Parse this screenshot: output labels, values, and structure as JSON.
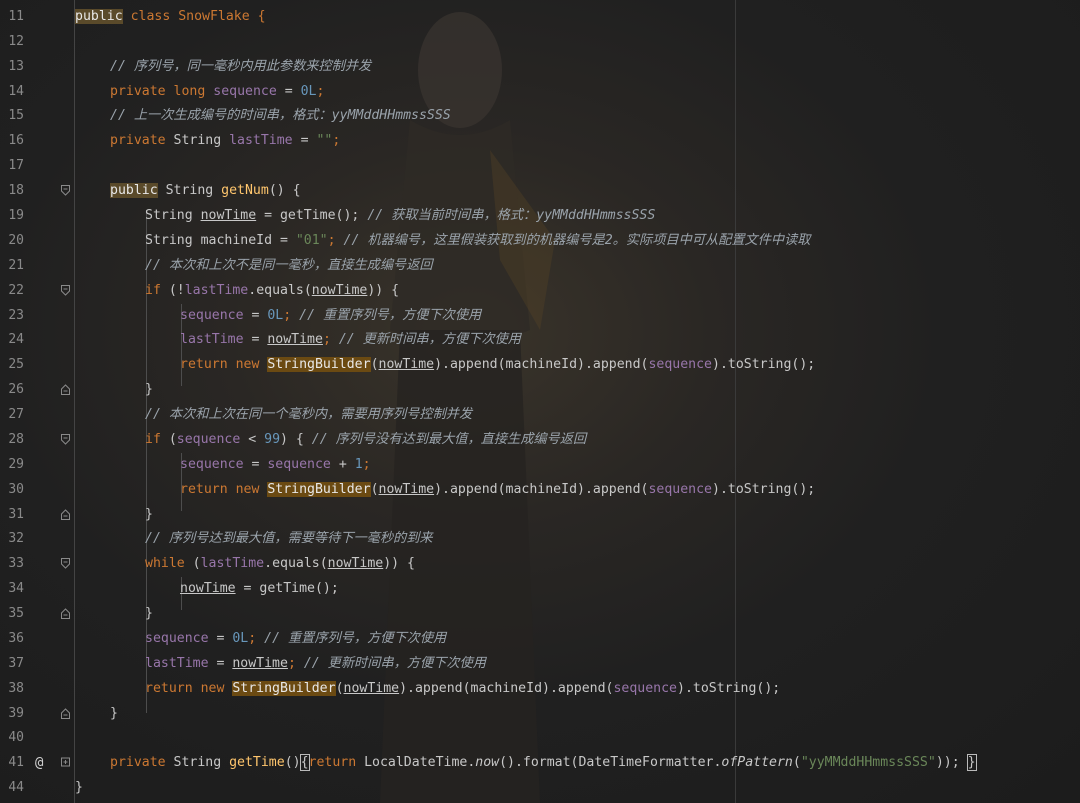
{
  "editor": {
    "line_numbers": [
      "11",
      "12",
      "13",
      "14",
      "15",
      "16",
      "17",
      "18",
      "19",
      "20",
      "21",
      "22",
      "23",
      "24",
      "25",
      "26",
      "27",
      "28",
      "29",
      "30",
      "31",
      "32",
      "33",
      "34",
      "35",
      "36",
      "37",
      "38",
      "39",
      "40",
      "41",
      "44"
    ],
    "gutter_annotation": "@",
    "code": {
      "l11_public": "public",
      "l11_rest": " class SnowFlake {",
      "l13_comment": "// 序列号，同一毫秒内用此参数来控制并发",
      "l14_private": "private",
      "l14_long": "long",
      "l14_field": "sequence",
      "l14_eq": " = ",
      "l14_num": "0L",
      "l14_end": ";",
      "l15_comment": "// 上一次生成编号的时间串，格式：yyMMddHHmmssSSS",
      "l16_private": "private",
      "l16_type": " String ",
      "l16_field": "lastTime",
      "l16_eq": " = ",
      "l16_str": "\"\"",
      "l16_end": ";",
      "l18_public": "public",
      "l18_type": " String ",
      "l18_method": "getNum",
      "l18_end": "() {",
      "l19_type": "String ",
      "l19_var": "nowTime",
      "l19_mid": " = getTime(); ",
      "l19_comment": "// 获取当前时间串，格式：yyMMddHHmmssSSS",
      "l20_decl": "String machineId = ",
      "l20_str": "\"01\"",
      "l20_semi": "; ",
      "l20_comment": "// 机器编号，这里假装获取到的机器编号是2。实际项目中可从配置文件中读取",
      "l21_comment": "// 本次和上次不是同一毫秒，直接生成编号返回",
      "l22_if": "if",
      "l22_a": " (!",
      "l22_field": "lastTime",
      "l22_b": ".equals(",
      "l22_var": "nowTime",
      "l22_c": ")) {",
      "l23_field": "sequence",
      "l23_eq": " = ",
      "l23_num": "0L",
      "l23_semi": "; ",
      "l23_comment": "// 重置序列号，方便下次使用",
      "l24_field": "lastTime",
      "l24_eq": " = ",
      "l24_var": "nowTime",
      "l24_semi": "; ",
      "l24_comment": "// 更新时间串，方便下次使用",
      "ret_return": "return",
      "ret_new": " new ",
      "ret_sb": "StringBuilder",
      "ret_open": "(",
      "ret_var": "nowTime",
      "ret_mid": ").append(machineId).append(",
      "ret_field": "sequence",
      "ret_end": ").toString();",
      "close_brace": "}",
      "l27_comment": "// 本次和上次在同一个毫秒内，需要用序列号控制并发",
      "l28_if": "if",
      "l28_a": " (",
      "l28_field": "sequence",
      "l28_b": " < ",
      "l28_num": "99",
      "l28_c": ") { ",
      "l28_comment": "// 序列号没有达到最大值，直接生成编号返回",
      "l29_field": "sequence",
      "l29_eq": " = ",
      "l29_field2": "sequence",
      "l29_plus": " + ",
      "l29_num": "1",
      "l29_end": ";",
      "l32_comment": "// 序列号达到最大值，需要等待下一毫秒的到来",
      "l33_while": "while",
      "l33_a": " (",
      "l33_field": "lastTime",
      "l33_b": ".equals(",
      "l33_var": "nowTime",
      "l33_c": ")) {",
      "l34_var": "nowTime",
      "l34_end": " = getTime();",
      "l36_field": "sequence",
      "l36_eq": " = ",
      "l36_num": "0L",
      "l36_semi": "; ",
      "l36_comment": "// 重置序列号，方便下次使用",
      "l37_field": "lastTime",
      "l37_eq": " = ",
      "l37_var": "nowTime",
      "l37_semi": "; ",
      "l37_comment": "// 更新时间串，方便下次使用",
      "l41_private": "private",
      "l41_type": " String ",
      "l41_method": "getTime",
      "l41_paren": "()",
      "l41_brace_open": "{",
      "l41_return": "return",
      "l41_a": " LocalDateTime.",
      "l41_now": "now",
      "l41_b": "().format(DateTimeFormatter.",
      "l41_ofp": "ofPattern",
      "l41_c": "(",
      "l41_str": "\"yyMMddHHmmssSSS\"",
      "l41_d": ")); ",
      "l41_brace_close": "}",
      "l44_brace": "}"
    }
  }
}
